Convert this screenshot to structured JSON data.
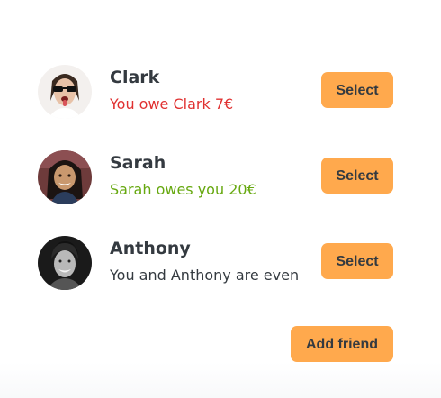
{
  "friends": [
    {
      "name": "Clark",
      "status": "You owe Clark 7€",
      "status_type": "owe",
      "status_color": "#e03131",
      "avatar_icon": "avatar-clark",
      "select_label": "Select"
    },
    {
      "name": "Sarah",
      "status": "Sarah owes you 20€",
      "status_type": "owed",
      "status_color": "#66a80f",
      "avatar_icon": "avatar-sarah",
      "select_label": "Select"
    },
    {
      "name": "Anthony",
      "status": "You and Anthony are even",
      "status_type": "even",
      "status_color": "#343a40",
      "avatar_icon": "avatar-anthony",
      "select_label": "Select"
    }
  ],
  "actions": {
    "add_friend_label": "Add friend"
  },
  "colors": {
    "button_bg": "#ffa94d",
    "text": "#343a40"
  }
}
